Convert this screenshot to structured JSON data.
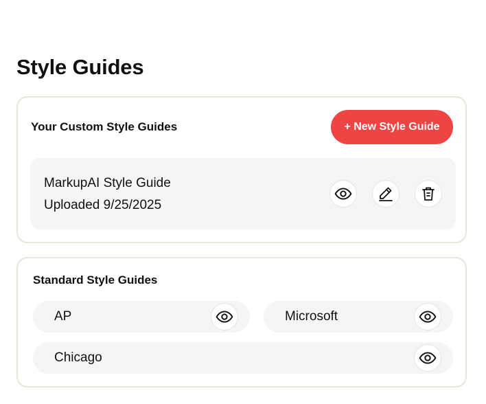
{
  "page": {
    "title": "Style Guides"
  },
  "custom_section": {
    "title": "Your Custom Style Guides",
    "new_button_label": "+ New Style Guide",
    "items": [
      {
        "name": "MarkupAI Style Guide",
        "uploaded": "Uploaded 9/25/2025",
        "actions": [
          "eye-icon",
          "pencil-icon",
          "trash-icon"
        ]
      }
    ]
  },
  "standard_section": {
    "title": "Standard Style Guides",
    "items": [
      {
        "label": "AP",
        "action": "eye-icon"
      },
      {
        "label": "Microsoft",
        "action": "eye-icon"
      },
      {
        "label": "Chicago",
        "action": "eye-icon"
      }
    ]
  },
  "colors": {
    "accent": "#ee4444",
    "card_border": "#e9e6da",
    "item_background": "#f5f5f5",
    "text": "#111111"
  }
}
